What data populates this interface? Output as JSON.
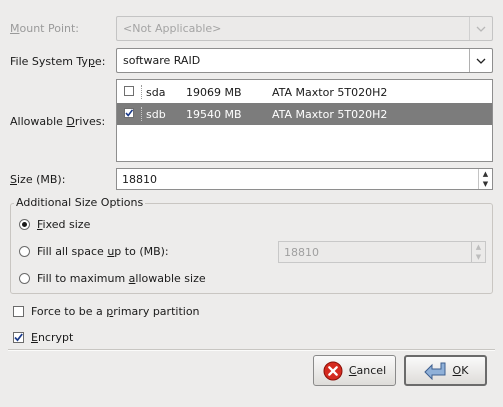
{
  "mount_point": {
    "label_pre": "",
    "label_mnemonic": "M",
    "label_post": "ount Point:",
    "value": "<Not Applicable>"
  },
  "fs_type": {
    "label_pre": "File System Ty",
    "label_mnemonic": "p",
    "label_post": "e:",
    "value": "software RAID"
  },
  "drives": {
    "label_pre": "Allowable ",
    "label_mnemonic": "D",
    "label_post": "rives:",
    "rows": [
      {
        "checked": false,
        "device": "sda",
        "size": "19069 MB",
        "model": "ATA Maxtor 5T020H2"
      },
      {
        "checked": true,
        "device": "sdb",
        "size": "19540 MB",
        "model": "ATA Maxtor 5T020H2"
      }
    ]
  },
  "size": {
    "label_pre": "",
    "label_mnemonic": "S",
    "label_post": "ize (MB):",
    "value": "18810"
  },
  "additional": {
    "title": "Additional Size Options",
    "fixed": {
      "pre": "",
      "mn": "F",
      "post": "ixed size",
      "selected": true
    },
    "fill_up": {
      "pre": "Fill all space ",
      "mn": "u",
      "post": "p to (MB):",
      "selected": false,
      "value": "18810"
    },
    "fill_max": {
      "pre": "Fill to maximum ",
      "mn": "a",
      "post": "llowable size",
      "selected": false
    }
  },
  "force_primary": {
    "pre": "Force to be a ",
    "mn": "p",
    "post": "rimary partition",
    "checked": false
  },
  "encrypt": {
    "pre": "",
    "mn": "E",
    "post": "ncrypt",
    "checked": true
  },
  "buttons": {
    "cancel": {
      "pre": "",
      "mn": "C",
      "post": "ancel"
    },
    "ok": {
      "pre": "",
      "mn": "O",
      "post": "K"
    }
  }
}
